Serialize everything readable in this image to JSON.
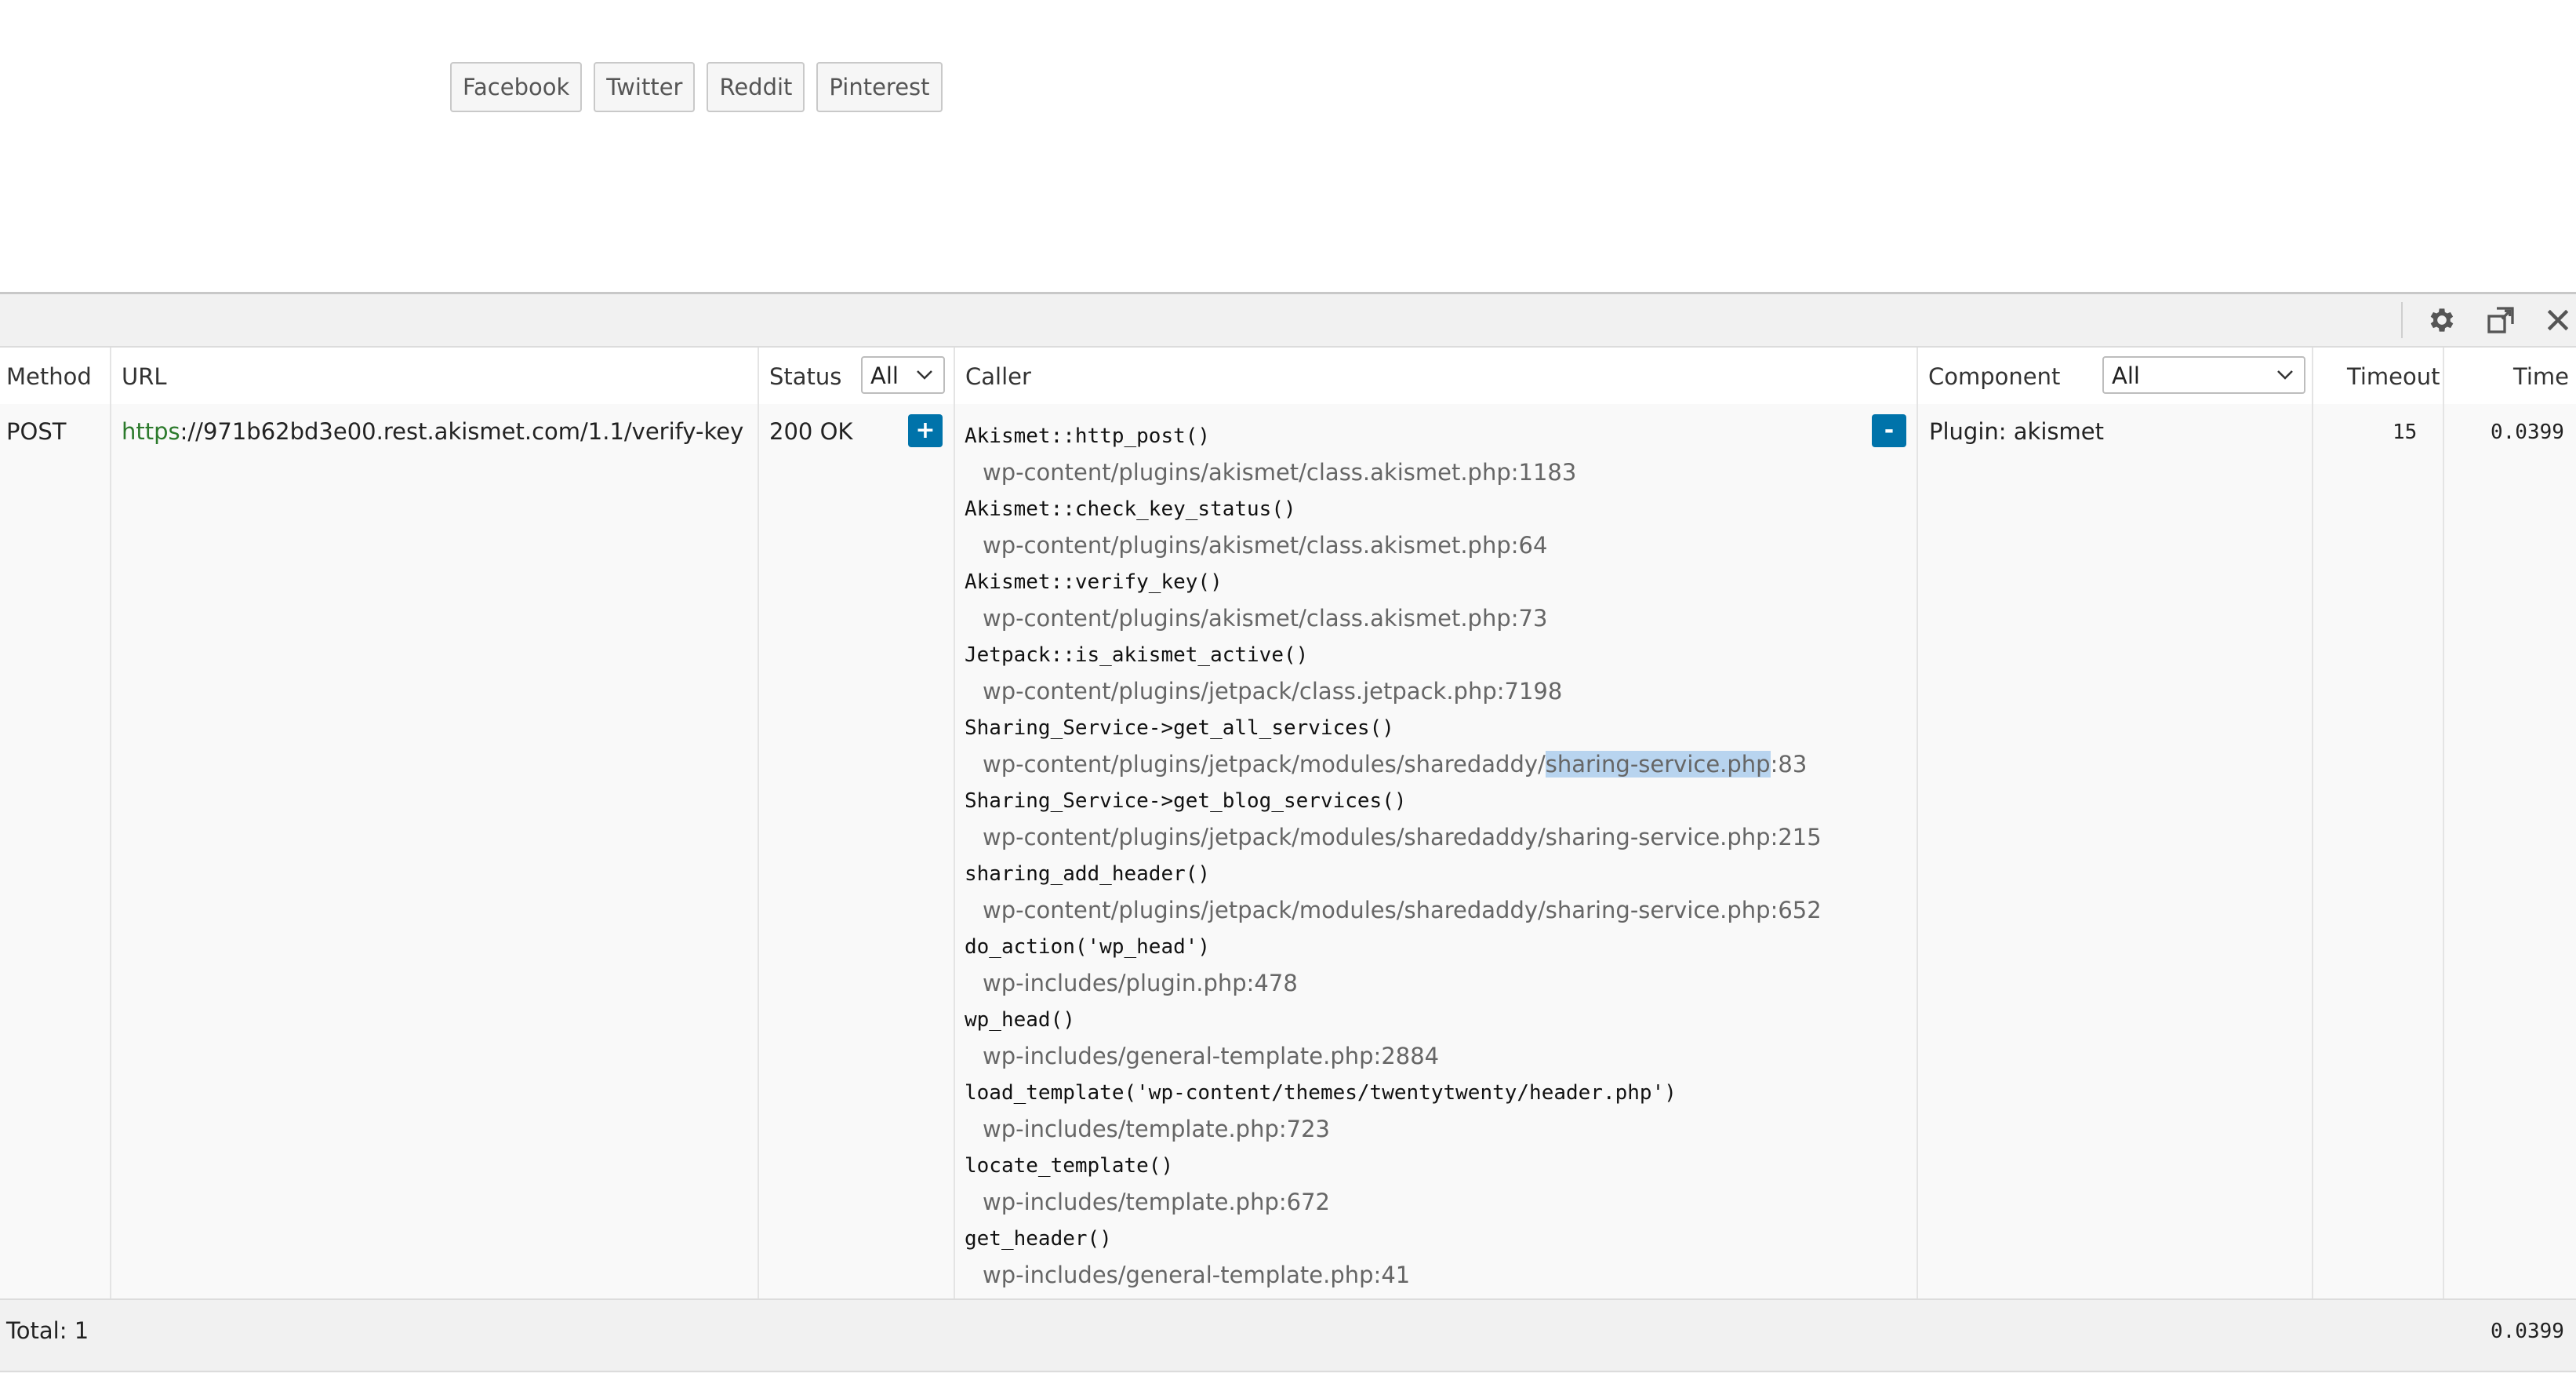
{
  "share_buttons": [
    "Facebook",
    "Twitter",
    "Reddit",
    "Pinterest"
  ],
  "toolbar": {
    "icons": [
      "settings-icon",
      "layout-icon",
      "close-icon"
    ]
  },
  "table": {
    "headers": {
      "method": "Method",
      "url": "URL",
      "status": "Status",
      "caller": "Caller",
      "component": "Component",
      "timeout": "Timeout",
      "time": "Time"
    },
    "status_filter": "All",
    "component_filter": "All",
    "row": {
      "method": "POST",
      "url_scheme": "https",
      "url_rest": "://971b62bd3e00.rest.akismet.com/1.1/verify-key",
      "status": "200 OK",
      "expand_label": "+",
      "collapse_label": "-",
      "component": "Plugin: akismet",
      "timeout": "15",
      "time": "0.0399",
      "callers": [
        {
          "fn": "Akismet::http_post()",
          "file": "wp-content/plugins/akismet/class.akismet.php:1183"
        },
        {
          "fn": "Akismet::check_key_status()",
          "file": "wp-content/plugins/akismet/class.akismet.php:64"
        },
        {
          "fn": "Akismet::verify_key()",
          "file": "wp-content/plugins/akismet/class.akismet.php:73"
        },
        {
          "fn": "Jetpack::is_akismet_active()",
          "file": "wp-content/plugins/jetpack/class.jetpack.php:7198"
        },
        {
          "fn": "Sharing_Service->get_all_services()",
          "file_pre": "wp-content/plugins/jetpack/modules/sharedaddy/",
          "file_hl": "sharing-service.php",
          "file_post": ":83"
        },
        {
          "fn": "Sharing_Service->get_blog_services()",
          "file": "wp-content/plugins/jetpack/modules/sharedaddy/sharing-service.php:215"
        },
        {
          "fn": "sharing_add_header()",
          "file": "wp-content/plugins/jetpack/modules/sharedaddy/sharing-service.php:652"
        },
        {
          "fn": "do_action('wp_head')",
          "file": "wp-includes/plugin.php:478"
        },
        {
          "fn": "wp_head()",
          "file": "wp-includes/general-template.php:2884"
        },
        {
          "fn": "load_template('wp-content/themes/twentytwenty/header.php')",
          "file": "wp-includes/template.php:723"
        },
        {
          "fn": "locate_template()",
          "file": "wp-includes/template.php:672"
        },
        {
          "fn": "get_header()",
          "file": "wp-includes/general-template.php:41"
        }
      ]
    },
    "footer": {
      "total": "Total: 1",
      "time": "0.0399"
    }
  }
}
